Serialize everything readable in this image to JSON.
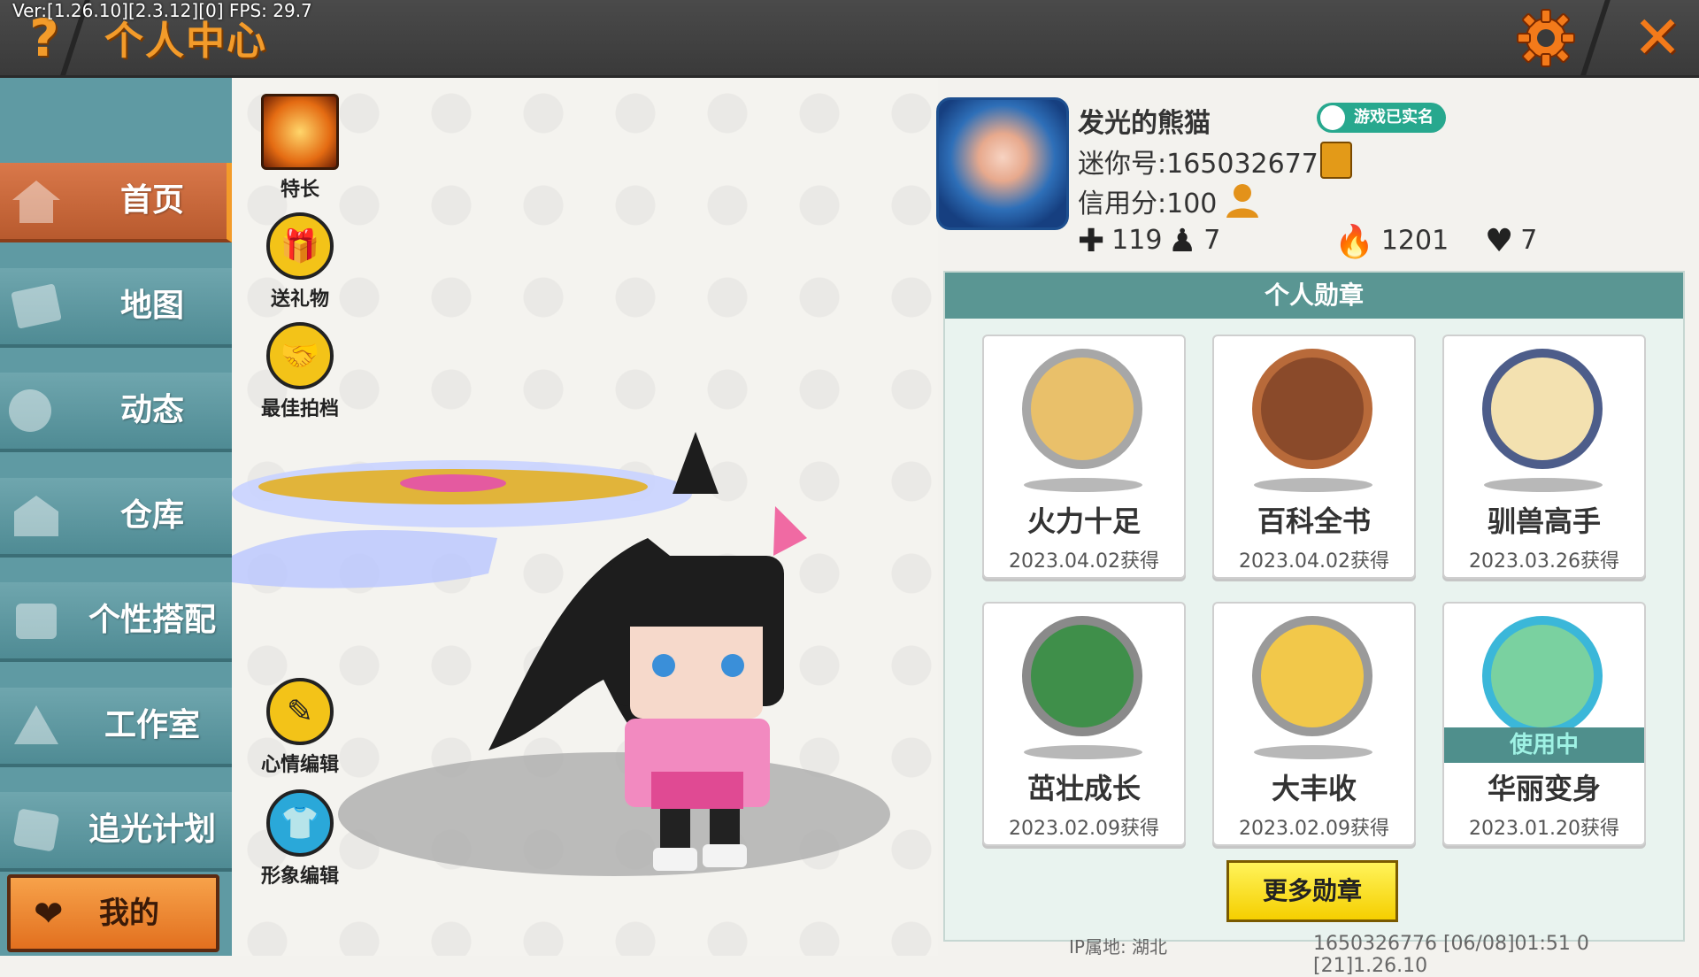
{
  "header": {
    "version": "Ver:[1.26.10][2.3.12][0] FPS: 29.7",
    "help": "?",
    "title": "个人中心",
    "close": "✕"
  },
  "sidebar": {
    "items": [
      {
        "label": "首页",
        "icon": "home-icon",
        "active": true
      },
      {
        "label": "地图",
        "icon": "map-icon",
        "active": false
      },
      {
        "label": "动态",
        "icon": "feed-icon",
        "active": false
      },
      {
        "label": "仓库",
        "icon": "warehouse-icon",
        "active": false
      },
      {
        "label": "个性搭配",
        "icon": "outfit-icon",
        "active": false
      },
      {
        "label": "工作室",
        "icon": "studio-icon",
        "active": false
      },
      {
        "label": "追光计划",
        "icon": "plan-icon",
        "active": false
      }
    ],
    "my": {
      "label": "我的",
      "icon": "heart-icon"
    }
  },
  "actions": {
    "specialty": "特长",
    "gift": "送礼物",
    "partner": "最佳拍档",
    "mood": "心情编辑",
    "appearance": "形象编辑"
  },
  "profile": {
    "name": "发光的熊猫",
    "verified": "游戏已实名",
    "mini_id": "迷你号:1650326776",
    "credit": "信用分:100",
    "stats": {
      "friends": "119",
      "fans": "7",
      "hot": "1201",
      "likes": "7"
    }
  },
  "badges": {
    "title": "个人勋章",
    "items": [
      {
        "name": "火力十足",
        "date": "2023.04.02获得",
        "color": "#a7a7a7",
        "inner": "#e9c06a",
        "in_use": ""
      },
      {
        "name": "百科全书",
        "date": "2023.04.02获得",
        "color": "#b86a3a",
        "inner": "#8a4a2a",
        "in_use": ""
      },
      {
        "name": "驯兽高手",
        "date": "2023.03.26获得",
        "color": "#4d5d8a",
        "inner": "#f3e1b0",
        "in_use": ""
      },
      {
        "name": "茁壮成长",
        "date": "2023.02.09获得",
        "color": "#8a8a8a",
        "inner": "#3f8f4a",
        "in_use": ""
      },
      {
        "name": "大丰收",
        "date": "2023.02.09获得",
        "color": "#9a9a9a",
        "inner": "#f2c84a",
        "in_use": ""
      },
      {
        "name": "华丽变身",
        "date": "2023.01.20获得",
        "color": "#3bb7d9",
        "inner": "#7ad1a0",
        "in_use": "使用中"
      }
    ],
    "more": "更多勋章"
  },
  "footer": {
    "ip": "IP属地: 湖北",
    "id_line": "1650326776    [06/08]01:51 0   [21]1.26.10"
  }
}
